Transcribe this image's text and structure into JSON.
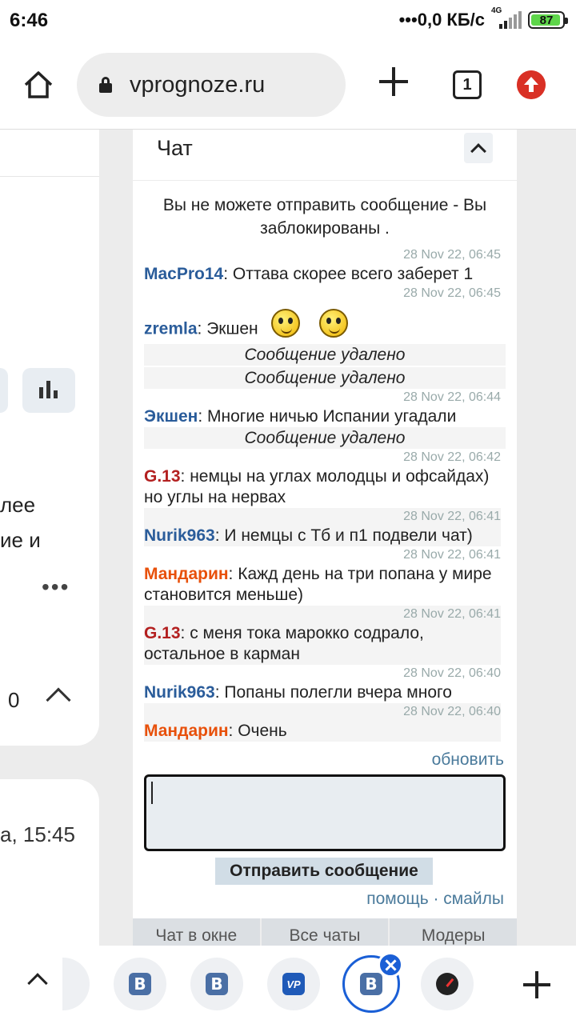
{
  "status_bar": {
    "time": "6:46",
    "network_speed": "•••0,0 КБ/с",
    "network_type": "4G",
    "battery": "87"
  },
  "browser": {
    "url": "vprognoze.ru",
    "tab_count": "1"
  },
  "left_partial": {
    "text1": "лее",
    "text2": "ие и",
    "dots": "•••",
    "count": "0",
    "time": "а, 15:45"
  },
  "chat": {
    "title": "Чат",
    "blocked_notice": "Вы не можете отправить сообщение - Вы заблокированы .",
    "deleted_text": "Сообщение удалено",
    "messages": [
      {
        "time": "28 Nov 22, 06:45",
        "nick": "MacPro14",
        "text": ": Оттава скорее всего заберет 1"
      },
      {
        "time": "28 Nov 22, 06:45",
        "nick": "zremla",
        "text": ": Экшен"
      },
      {
        "time": "28 Nov 22, 06:44",
        "nick": "Экшен",
        "text": ": Многие ничью Испании угадали"
      },
      {
        "time": "28 Nov 22, 06:42",
        "nick": "G.13",
        "text": ": немцы на углах молодцы и офсайдах) но углы на нервах"
      },
      {
        "time": "28 Nov 22, 06:41",
        "nick": "Nurik963",
        "text": ": И немцы с Тб и п1 подвели чат)"
      },
      {
        "time": "28 Nov 22, 06:41",
        "nick": "Мандарин",
        "text": ": Кажд день на три попана у мире становится меньше)"
      },
      {
        "time": "28 Nov 22, 06:41",
        "nick": "G.13",
        "text": ": с меня тока марокко содрало, остальное в карман"
      },
      {
        "time": "28 Nov 22, 06:40",
        "nick": "Nurik963",
        "text": ": Попаны полегли вчера много"
      },
      {
        "time": "28 Nov 22, 06:40",
        "nick": "Мандарин",
        "text": ": Очень"
      }
    ],
    "refresh_label": "обновить",
    "send_label": "Отправить сообщение",
    "help_links": "помощь · смайлы",
    "bottom_tabs": [
      "Чат в окне",
      "Все чаты",
      "Модеры"
    ]
  },
  "colors": {
    "nick_blue": "#2a5c9a",
    "nick_red": "#b32020",
    "nick_orange": "#e8500a",
    "link": "#4a7a9b"
  },
  "bottom_bar": {
    "tabs": [
      "vk-icon",
      "vk-icon",
      "vp-icon",
      "vk-icon-active",
      "speed-icon"
    ]
  }
}
